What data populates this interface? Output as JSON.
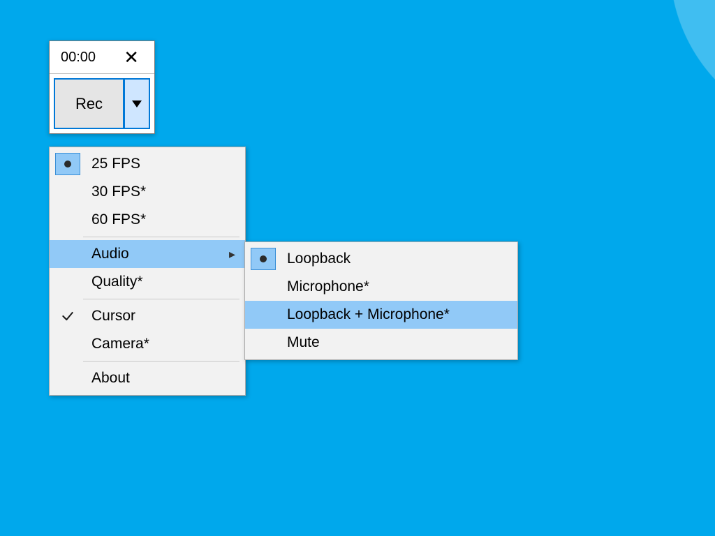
{
  "widget": {
    "time": "00:00",
    "close_glyph": "✕",
    "rec_label": "Rec"
  },
  "main_menu": {
    "items": [
      {
        "label": "25 FPS"
      },
      {
        "label": "30 FPS*"
      },
      {
        "label": "60 FPS*"
      },
      {
        "label": "Audio"
      },
      {
        "label": "Quality*"
      },
      {
        "label": "Cursor"
      },
      {
        "label": "Camera*"
      },
      {
        "label": "About"
      }
    ]
  },
  "audio_submenu": {
    "items": [
      {
        "label": "Loopback"
      },
      {
        "label": "Microphone*"
      },
      {
        "label": "Loopback + Microphone*"
      },
      {
        "label": "Mute"
      }
    ]
  }
}
